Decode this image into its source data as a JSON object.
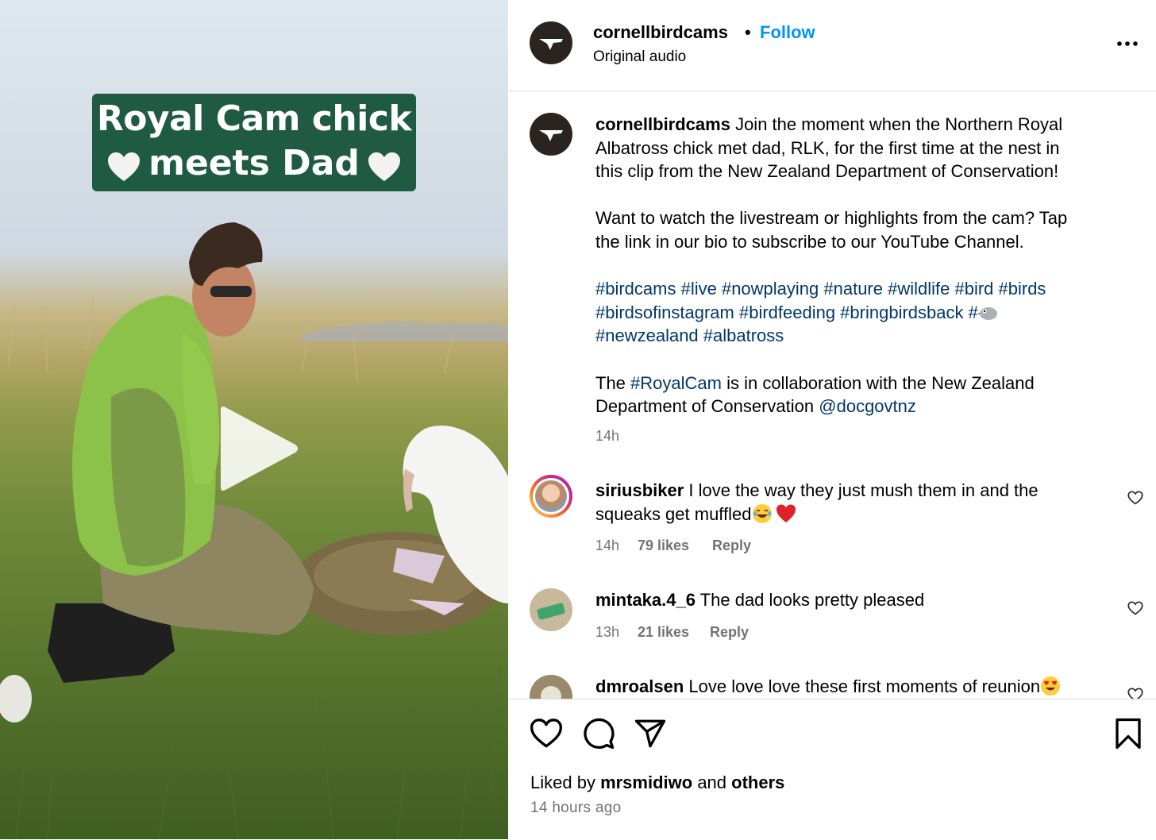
{
  "media": {
    "caption_line1": "Royal Cam chick",
    "caption_line2": "meets Dad"
  },
  "header": {
    "username": "cornellbirdcams",
    "dot": "•",
    "follow_label": "Follow",
    "audio": "Original audio"
  },
  "post": {
    "username": "cornellbirdcams",
    "line1": " Join the moment when the Northern Royal",
    "line2": "Albatross chick met dad, RLK, for the first time at the nest in",
    "line3": "this clip from the New Zealand Department of Conservation!",
    "para2_line1": "Want to watch the livestream or highlights from the cam? Tap",
    "para2_line2": "the link in our bio to subscribe to our YouTube Channel.",
    "tags_line1": "#birdcams #live #nowplaying #nature #wildlife #bird #birds",
    "tags_line2": "#birdsofinstagram #birdfeeding #bringbirdsback #",
    "tags_line3": "#newzealand #albatross",
    "collab_pre": "The ",
    "collab_tag": "#RoyalCam",
    "collab_post": " is in collaboration with the New Zealand",
    "collab_line2": "Department of Conservation ",
    "collab_mention": "@docgovtnz",
    "time": "14h"
  },
  "comments": [
    {
      "username": "siriusbiker",
      "text_line1": " I love the way they just mush them in and the",
      "text_line2": "squeaks get muffled",
      "time": "14h",
      "likes": "79 likes",
      "reply": "Reply"
    },
    {
      "username": "mintaka.4_6",
      "text_line1": " The dad looks pretty pleased",
      "time": "13h",
      "likes": "21 likes",
      "reply": "Reply"
    },
    {
      "username": "dmroalsen",
      "text_line1": " Love love love these first moments of reunion"
    }
  ],
  "footer": {
    "liked_pre": "Liked by ",
    "liked_user": "mrsmidiwo",
    "liked_mid": " and ",
    "liked_others": "others",
    "ago": "14 hours ago"
  },
  "icons": {
    "like": "heart-outline-icon",
    "comment": "comment-bubble-icon",
    "share": "paper-plane-icon",
    "save": "bookmark-icon",
    "more": "more-dots-icon"
  },
  "colors": {
    "follow_blue": "#0095f6",
    "hashtag": "#00376b",
    "muted": "#737373",
    "caption_bg": "#1f5a42"
  }
}
